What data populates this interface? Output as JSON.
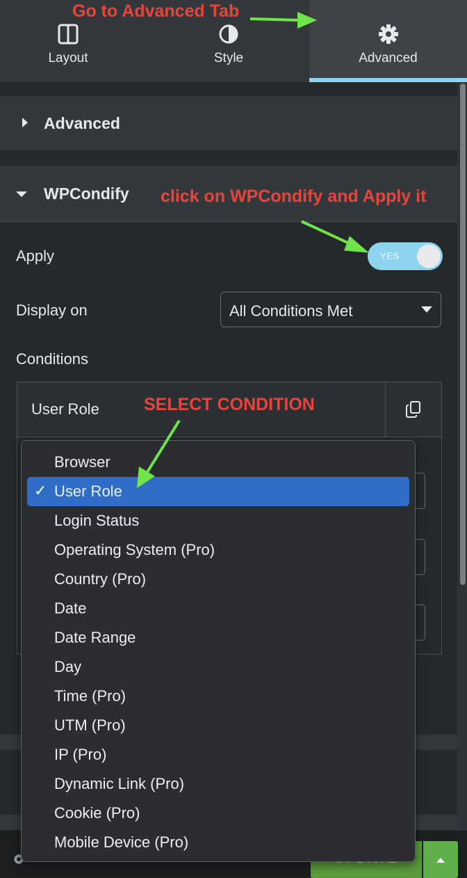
{
  "tabs": [
    {
      "label": "Layout",
      "icon": "layout-columns-icon"
    },
    {
      "label": "Style",
      "icon": "contrast-half-circle-icon"
    },
    {
      "label": "Advanced",
      "icon": "gear-icon",
      "active": true
    }
  ],
  "sections": {
    "advanced": {
      "title": "Advanced",
      "state": "collapsed"
    },
    "wpcondify": {
      "title": "WPCondify",
      "state": "expanded"
    }
  },
  "controls": {
    "apply_label": "Apply",
    "apply_toggle_text": "YES",
    "display_on_label": "Display on",
    "display_on_value": "All Conditions Met",
    "conditions_label": "Conditions"
  },
  "repeater": {
    "item_title": "User Role"
  },
  "footer": {
    "publish_label": "UPDATE"
  },
  "menu": {
    "items": [
      {
        "label": "Browser",
        "selected": false
      },
      {
        "label": "User Role",
        "selected": true
      },
      {
        "label": "Login Status",
        "selected": false
      },
      {
        "label": "Operating System (Pro)",
        "selected": false
      },
      {
        "label": "Country (Pro)",
        "selected": false
      },
      {
        "label": "Date",
        "selected": false
      },
      {
        "label": "Date Range",
        "selected": false
      },
      {
        "label": "Day",
        "selected": false
      },
      {
        "label": "Time (Pro)",
        "selected": false
      },
      {
        "label": "UTM (Pro)",
        "selected": false
      },
      {
        "label": "IP (Pro)",
        "selected": false
      },
      {
        "label": "Dynamic Link (Pro)",
        "selected": false
      },
      {
        "label": "Cookie (Pro)",
        "selected": false
      },
      {
        "label": "Mobile Device (Pro)",
        "selected": false
      }
    ],
    "check_glyph": "✓"
  },
  "annotations": {
    "advanced_tab": "Go to Advanced Tab",
    "apply": "click on WPCondify and Apply it",
    "select": "SELECT CONDITION"
  },
  "colors": {
    "accent": "#8fd4ef",
    "annotation": "#e8453a",
    "arrow": "#6ee64a",
    "selected": "#2f6dc8",
    "publish": "#5fb04a"
  }
}
